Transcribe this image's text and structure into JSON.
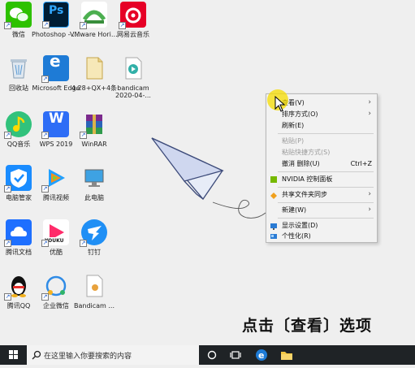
{
  "desktop_icons": [
    {
      "label": "微信"
    },
    {
      "label": "Photoshop - 快捷方式",
      "badge": "Ps"
    },
    {
      "label": "VMware Horizon..."
    },
    {
      "label": "网易云音乐"
    },
    {
      "label": "回收站"
    },
    {
      "label": "Microsoft Edge"
    },
    {
      "label": "4.28+QX+4条"
    },
    {
      "label": "bandicam 2020-04-..."
    },
    {
      "label": "QQ音乐"
    },
    {
      "label": "WPS 2019",
      "badge": "W"
    },
    {
      "label": "WinRAR"
    },
    {
      "label": "电脑管家"
    },
    {
      "label": "腾讯视频"
    },
    {
      "label": "此电脑"
    },
    {
      "label": "腾讯文档"
    },
    {
      "label": "优酷",
      "badge": "YOUKU"
    },
    {
      "label": "钉钉"
    },
    {
      "label": "腾讯QQ"
    },
    {
      "label": "企业微信"
    },
    {
      "label": "Bandicam ..."
    }
  ],
  "context_menu": {
    "items": [
      {
        "label": "查看(V)",
        "arrow": "›"
      },
      {
        "label": "排序方式(O)",
        "arrow": "›"
      },
      {
        "label": "刷新(E)"
      },
      {
        "label": "粘贴(P)",
        "disabled": true
      },
      {
        "label": "粘贴快捷方式(S)",
        "disabled": true
      },
      {
        "label": "撤消 删除(U)",
        "shortcut": "Ctrl+Z"
      },
      {
        "label": "NVIDIA 控制面板"
      },
      {
        "label": "共享文件夹同步",
        "arrow": "›"
      },
      {
        "label": "新建(W)",
        "arrow": "›"
      },
      {
        "label": "显示设置(D)"
      },
      {
        "label": "个性化(R)"
      }
    ]
  },
  "caption": "点击〔查看〕选项",
  "taskbar": {
    "search_placeholder": "在这里输入你要搜索的内容"
  },
  "colors": {
    "highlight": "#f5dc00",
    "taskbar": "#1f2326",
    "accent_blue": "#1e7bd6"
  }
}
